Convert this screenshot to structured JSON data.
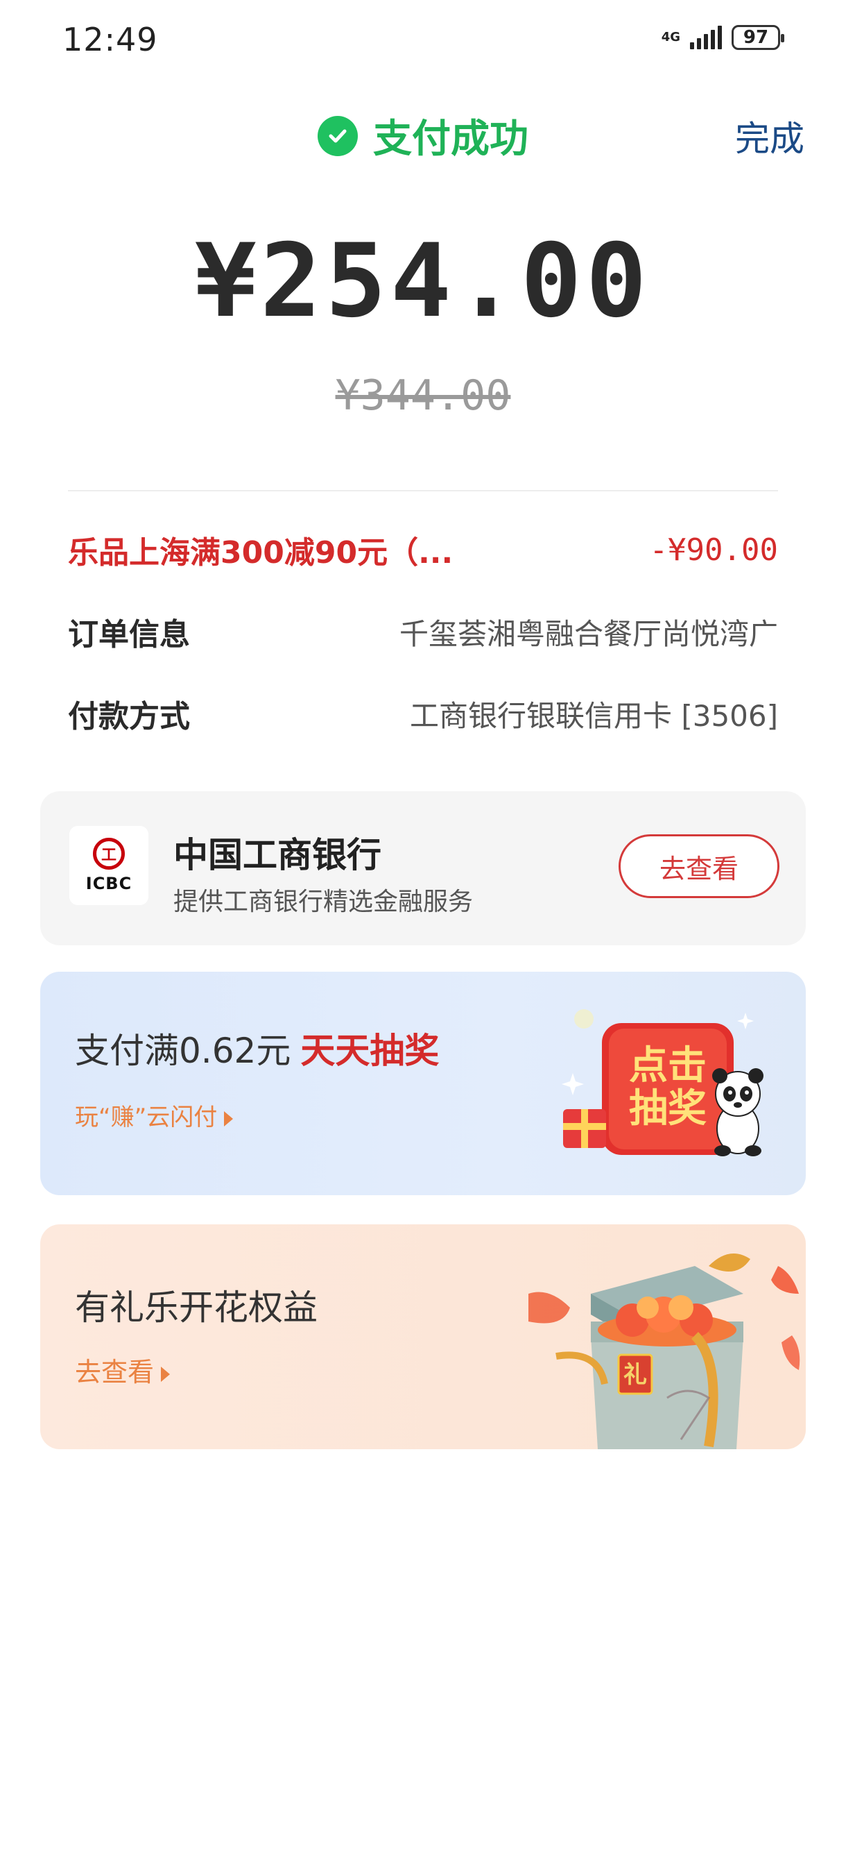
{
  "status_bar": {
    "time": "12:49",
    "network": "4G",
    "battery": "97"
  },
  "header": {
    "title": "支付成功",
    "done_label": "完成"
  },
  "amount": {
    "paid": "¥254.00",
    "original": "¥344.00"
  },
  "discount": {
    "label": "乐品上海满300减90元（...",
    "value": "-¥90.00"
  },
  "order": {
    "label": "订单信息",
    "value": "千玺荟湘粤融合餐厅尚悦湾广"
  },
  "payment": {
    "label": "付款方式",
    "value": "工商银行银联信用卡 [3506]"
  },
  "bank_card": {
    "logo_text": "ICBC",
    "name": "中国工商银行",
    "desc": "提供工商银行精选金融服务",
    "button": "去查看"
  },
  "lottery_card": {
    "title": "支付满0.62元",
    "highlight": "天天抽奖",
    "link": "玩“赚”云闪付",
    "image_text_1": "点击",
    "image_text_2": "抽奖"
  },
  "gift_card": {
    "title": "有礼乐开花权益",
    "link": "去查看",
    "image_char": "礼"
  },
  "colors": {
    "success": "#1fb257",
    "discount": "#d42b2b",
    "accent": "#ea8242",
    "done": "#1b4a86"
  }
}
